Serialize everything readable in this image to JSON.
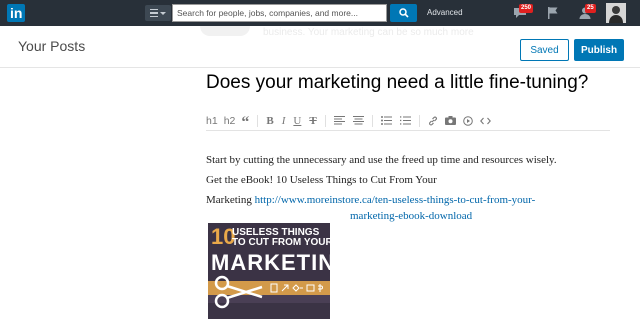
{
  "nav": {
    "logo_text": "in",
    "search_placeholder": "Search for people, jobs, companies, and more...",
    "advanced_label": "Advanced",
    "messages_count": "250",
    "notifications_count": "25"
  },
  "header": {
    "title": "Your Posts",
    "saved_label": "Saved",
    "publish_label": "Publish",
    "faded_text": "business. Your marketing can be so much more"
  },
  "editor": {
    "title": "Does your marketing need a little fine-tuning?",
    "toolbar": {
      "h1": "h1",
      "h2": "h2",
      "quote": "“",
      "bold": "B",
      "italic": "I",
      "underline": "U",
      "strike": "T"
    },
    "paragraph_line1": "Start by cutting the unnecessary and use the freed up time and resources wisely.",
    "paragraph_line2": "Get the eBook! 10 Useless Things to Cut From Your",
    "paragraph_line3_prefix": "Marketing ",
    "link_part1": "http://www.moreinstore.ca/ten-useless-things-to-cut-from-your-",
    "link_part2": "marketing-ebook-download"
  },
  "ebook_image": {
    "number": "10",
    "line1": "USELESS THINGS",
    "line2": "TO CUT FROM YOUR",
    "line3": "MARKETING"
  },
  "colors": {
    "nav_bg": "#283039",
    "accent": "#0077b5",
    "badge": "#e0201f",
    "link": "#0066aa"
  }
}
